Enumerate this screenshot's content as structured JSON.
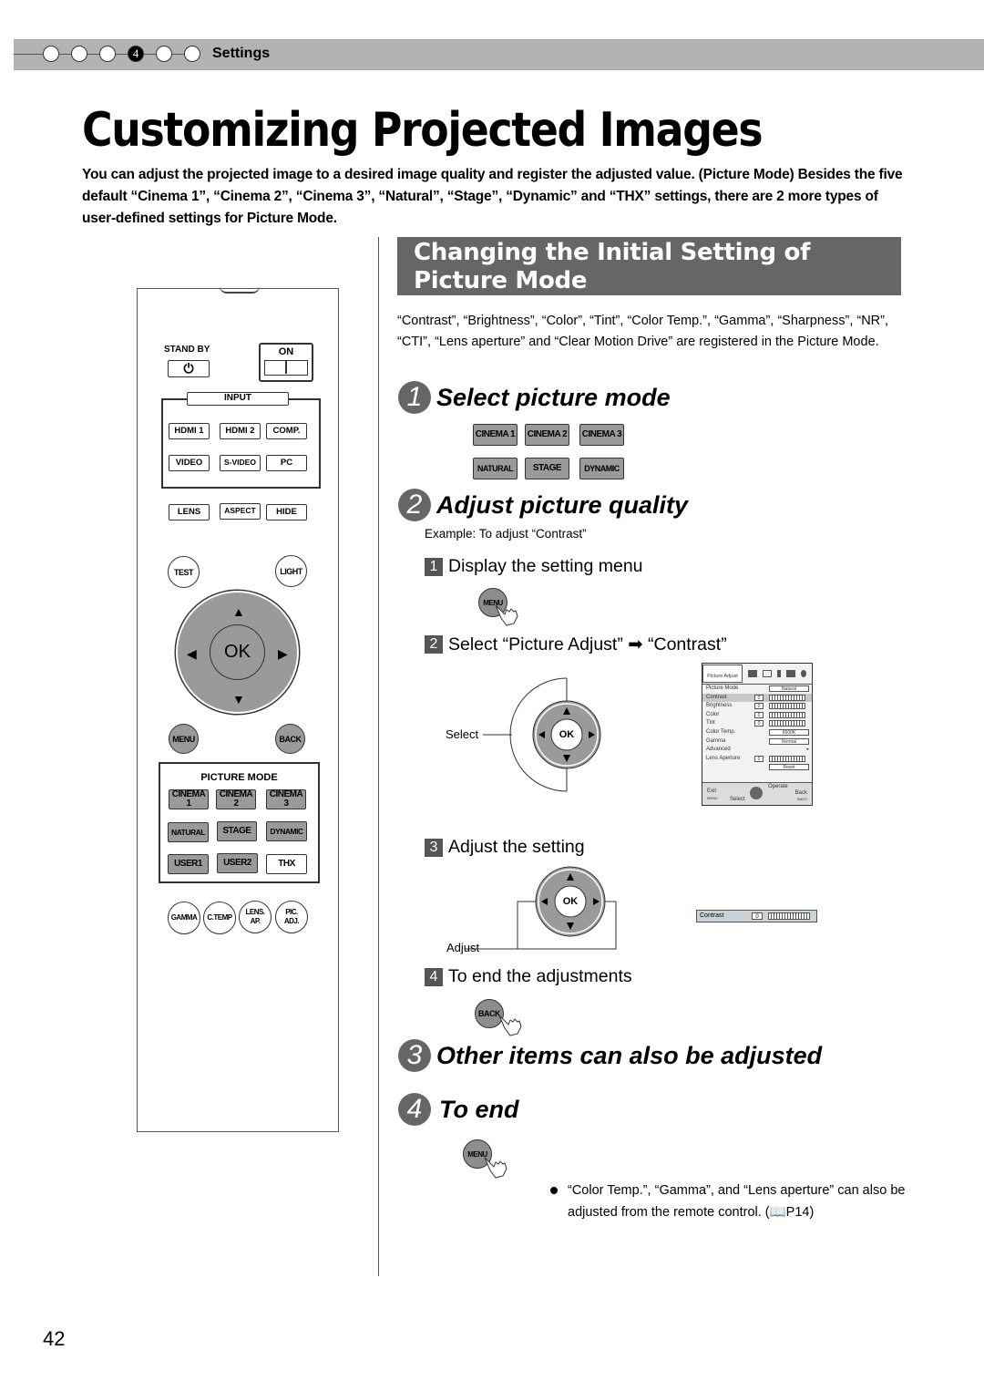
{
  "header": {
    "steps": [
      "",
      "",
      "",
      "4",
      "",
      ""
    ],
    "active_step": 4,
    "crumb": "Settings"
  },
  "title": "Customizing Projected Images",
  "intro": "You can adjust the projected image to a desired image quality and register the adjusted value. (Picture Mode) Besides the five default “Cinema 1”, “Cinema 2”, “Cinema 3”, “Natural”, “Stage”, “Dynamic” and “THX” settings, there are 2 more types of user-defined settings for Picture Mode.",
  "remote": {
    "standby_label": "STAND BY",
    "on_label": "ON",
    "input_label": "INPUT",
    "input_buttons": [
      "HDMI 1",
      "HDMI 2",
      "COMP.",
      "VIDEO",
      "S-VIDEO",
      "PC"
    ],
    "row_buttons": [
      "LENS",
      "ASPECT",
      "HIDE"
    ],
    "test": "TEST",
    "light": "LIGHT",
    "ok": "OK",
    "menu": "MENU",
    "back": "BACK",
    "picture_mode_label": "PICTURE MODE",
    "picture_mode_buttons": [
      "CINEMA 1",
      "CINEMA 2",
      "CINEMA 3",
      "NATURAL",
      "STAGE",
      "DYNAMIC",
      "USER1",
      "USER2",
      "THX"
    ],
    "bottom_buttons": [
      "GAMMA",
      "C.TEMP",
      "LENS. AP.",
      "PIC. ADJ."
    ]
  },
  "section": {
    "title_line1": "Changing the Initial Setting of",
    "title_line2": "Picture Mode",
    "description": "“Contrast”, “Brightness”, “Color”, “Tint”, “Color Temp.”, “Gamma”, “Sharpness”, “NR”, “CTI”, “Lens aperture” and “Clear Motion Drive” are registered in the Picture Mode."
  },
  "steps": [
    {
      "num": "1",
      "title": "Select picture mode"
    },
    {
      "num": "2",
      "title": "Adjust picture quality"
    },
    {
      "num": "3",
      "title": "Other items can also be adjusted"
    },
    {
      "num": "4",
      "title": "To end"
    }
  ],
  "mode_buttons": [
    "CINEMA 1",
    "CINEMA 2",
    "CINEMA 3",
    "NATURAL",
    "STAGE",
    "DYNAMIC"
  ],
  "example": "Example: To adjust “Contrast”",
  "substeps": [
    {
      "num": "1",
      "text": "Display the setting menu",
      "button": "MENU"
    },
    {
      "num": "2",
      "text": "Select “Picture Adjust” ➡ “Contrast”",
      "label": "Select",
      "ok": "OK"
    },
    {
      "num": "3",
      "text": "Adjust the setting",
      "label": "Adjust",
      "ok": "OK"
    },
    {
      "num": "4",
      "text": "To end the adjustments",
      "button": "BACK"
    }
  ],
  "osd": {
    "tab": "Picture Adjust",
    "rows": [
      {
        "label": "Picture Mode",
        "value": "Natural",
        "type": "select"
      },
      {
        "label": "Contrast",
        "value": "0",
        "type": "slider",
        "highlight": true
      },
      {
        "label": "Brightness",
        "value": "0",
        "type": "slider"
      },
      {
        "label": "Color",
        "value": "0",
        "type": "slider"
      },
      {
        "label": "Tint",
        "value": "0",
        "type": "slider"
      },
      {
        "label": "Color Temp.",
        "value": "6500K",
        "type": "select"
      },
      {
        "label": "Gamma",
        "value": "Normal",
        "type": "select"
      },
      {
        "label": "Advanced",
        "value": "",
        "type": "submenu"
      },
      {
        "label": "Lens Aperture",
        "value": "0",
        "type": "slider"
      },
      {
        "label": "",
        "value": "Reset",
        "type": "select"
      }
    ],
    "footer": {
      "exit": "Exit",
      "exit_key": "MENU",
      "select": "Select",
      "operate": "Operate",
      "back": "Back",
      "back_key": "BACK"
    }
  },
  "contrast_bar": {
    "label": "Contrast",
    "value": "0"
  },
  "end_button": "MENU",
  "note": "“Color Temp.”, “Gamma”, and “Lens aperture” can also be adjusted from the remote control. (📖P14)",
  "page_number": "42"
}
